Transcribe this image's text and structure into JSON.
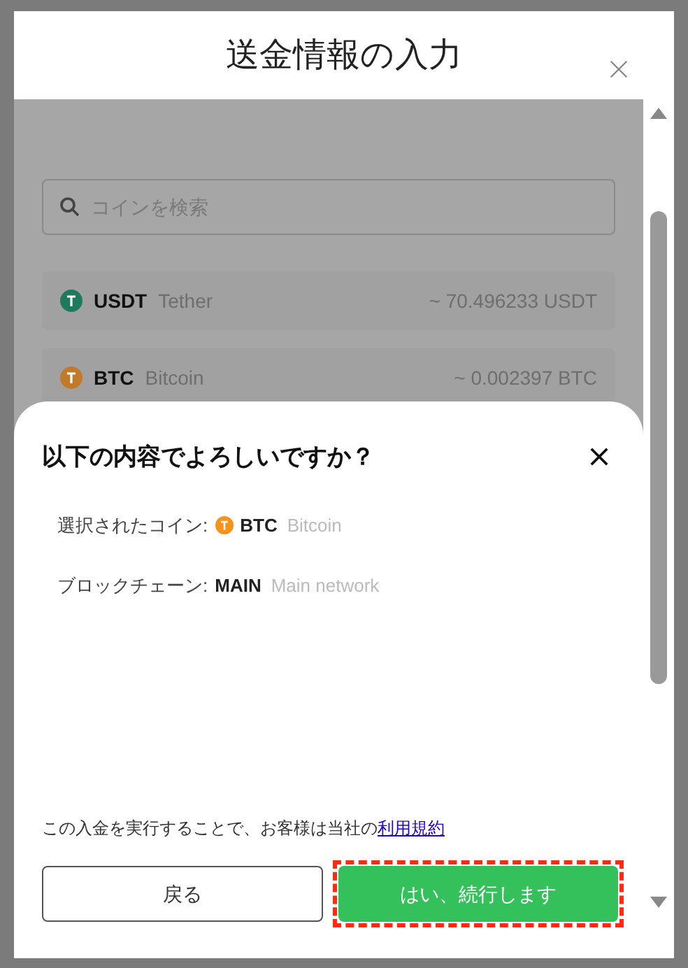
{
  "dialog": {
    "title": "送金情報の入力"
  },
  "search": {
    "placeholder": "コインを検索"
  },
  "coins": [
    {
      "symbol": "USDT",
      "name": "Tether",
      "balance": "~ 70.496233 USDT",
      "color": "#1e7a5c"
    },
    {
      "symbol": "BTC",
      "name": "Bitcoin",
      "balance": "~ 0.002397 BTC",
      "color": "#c07a2a"
    }
  ],
  "confirm": {
    "title": "以下の内容でよろしいですか？",
    "rows": [
      {
        "kind": "coin",
        "label": "選択されたコイン:",
        "code": "BTC",
        "name": "Bitcoin",
        "color": "#f7931a"
      },
      {
        "kind": "network",
        "label": "ブロックチェーン:",
        "code": "MAIN",
        "name": "Main network"
      }
    ],
    "terms": {
      "text": "この入金を実行することで、お客様は当社の",
      "link": "利用規約"
    },
    "buttons": [
      {
        "kind": "secondary",
        "label": "戻る",
        "highlighted": false
      },
      {
        "kind": "primary",
        "label": "はい、続行します",
        "highlighted": true
      }
    ]
  }
}
